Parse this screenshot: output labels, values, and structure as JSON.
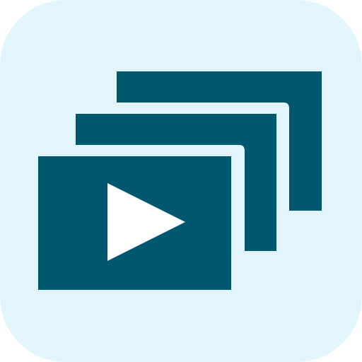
{
  "icon": {
    "name": "video-playlist-icon",
    "colors": {
      "background": "#E2F4FC",
      "frame": "#005870",
      "play": "#FFFFFF"
    }
  }
}
